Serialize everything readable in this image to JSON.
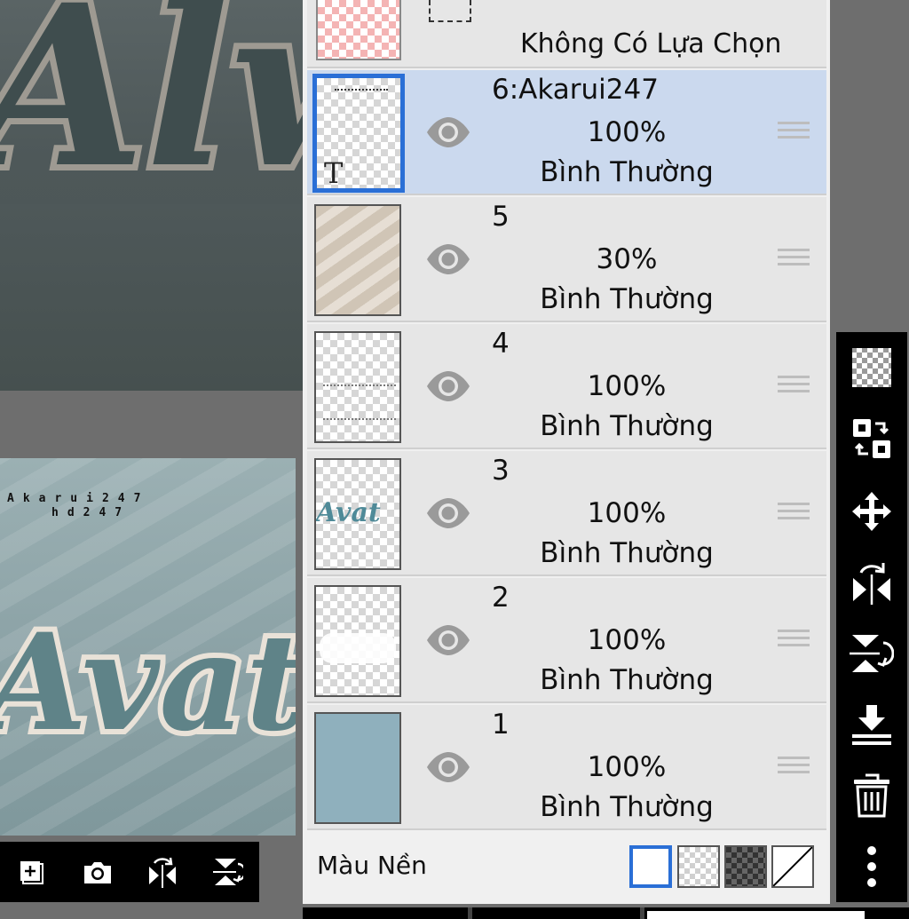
{
  "canvas": {
    "top_artwork_text": "Alw",
    "preview_watermark_line1": "Akarui247",
    "preview_watermark_line2": "hd247",
    "preview_artwork_text": "Avat"
  },
  "canvas_toolbar": {
    "icons": [
      "add-layer-icon",
      "camera-icon",
      "flip-horizontal-icon",
      "flip-vertical-icon"
    ]
  },
  "selection_layer": {
    "label": "Không Có Lựa Chọn"
  },
  "layers": [
    {
      "name": "6:Akarui247",
      "opacity": "100%",
      "blend": "Bình Thường",
      "selected": true,
      "thumb_glyph": "T"
    },
    {
      "name": "5",
      "opacity": "30%",
      "blend": "Bình Thường",
      "selected": false
    },
    {
      "name": "4",
      "opacity": "100%",
      "blend": "Bình Thường",
      "selected": false
    },
    {
      "name": "3",
      "opacity": "100%",
      "blend": "Bình Thường",
      "selected": false,
      "thumb_text": "Avat"
    },
    {
      "name": "2",
      "opacity": "100%",
      "blend": "Bình Thường",
      "selected": false
    },
    {
      "name": "1",
      "opacity": "100%",
      "blend": "Bình Thường",
      "selected": false
    }
  ],
  "background": {
    "label": "Màu Nền",
    "options": [
      "white",
      "transparent",
      "dark-checker",
      "none"
    ],
    "selected": "white"
  },
  "tool_strip": {
    "icons": [
      "transparency-icon",
      "swap-layers-icon",
      "move-icon",
      "flip-horizontal-icon",
      "flip-vertical-icon",
      "merge-down-icon",
      "trash-icon",
      "more-vertical-icon"
    ]
  },
  "colors": {
    "selected_row": "#cbd9ee",
    "accent": "#2a6fd6",
    "layer1_fill": "#8fb0bd"
  }
}
